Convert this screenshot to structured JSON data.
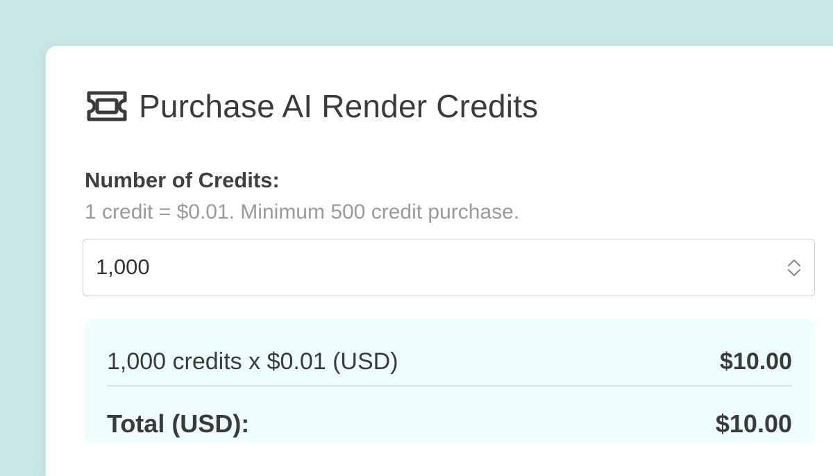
{
  "dialog": {
    "title": "Purchase AI Render Credits",
    "icon": "ticket-icon"
  },
  "credits": {
    "label": "Number of Credits:",
    "help_text": "1 credit = $0.01. Minimum 500 credit purchase.",
    "value": "1,000"
  },
  "summary": {
    "line_description": "1,000 credits x $0.01 (USD)",
    "line_amount": "$10.00",
    "total_label": "Total (USD):",
    "total_amount": "$10.00"
  },
  "colors": {
    "background": "#cbe8e7",
    "summary_background": "#eefefd",
    "text": "#3a3a3a",
    "muted_text": "#9a9a9a"
  }
}
